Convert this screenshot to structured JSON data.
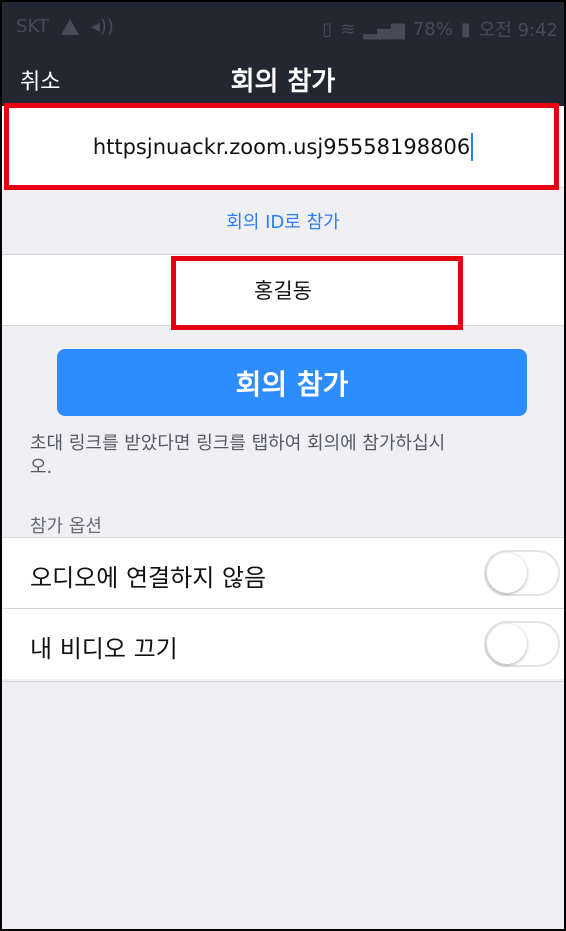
{
  "status_bar": {
    "carrier": "SKT",
    "battery": "78%",
    "time": "오전 9:42"
  },
  "nav": {
    "cancel_label": "취소",
    "title": "회의 참가"
  },
  "meeting_url": {
    "value": "httpsjnuackr.zoom.usj95558198806"
  },
  "join_by_id_label": "회의 ID로 참가",
  "display_name": {
    "value": "홍길동"
  },
  "join_button_label": "회의 참가",
  "help_text": "초대 링크를 받았다면 링크를 탭하여 회의에 참가하십시오.",
  "options": {
    "section_label": "참가 옵션",
    "items": [
      {
        "label": "오디오에 연결하지 않음",
        "enabled": false
      },
      {
        "label": "내 비디오 끄기",
        "enabled": false
      }
    ]
  },
  "colors": {
    "header_bg": "#232732",
    "accent_blue": "#2d8cff",
    "highlight_red": "#e60012",
    "background": "#efeff4"
  }
}
